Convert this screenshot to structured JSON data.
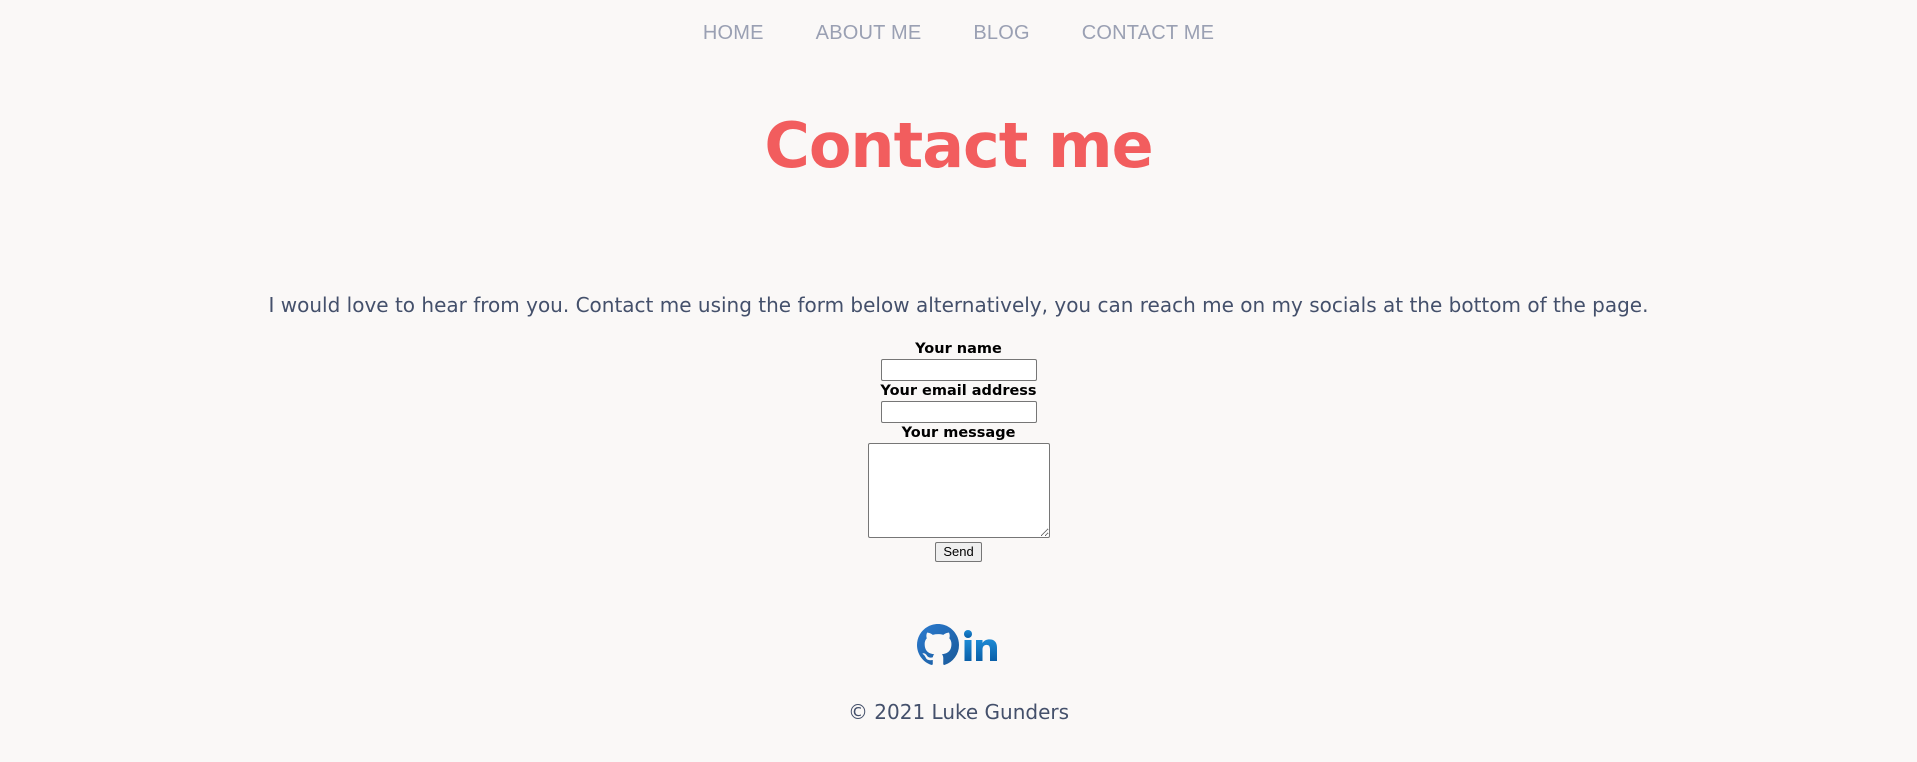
{
  "nav": {
    "items": [
      {
        "label": "HOME"
      },
      {
        "label": "ABOUT ME"
      },
      {
        "label": "BLOG"
      },
      {
        "label": "CONTACT ME"
      }
    ]
  },
  "page": {
    "title": "Contact me",
    "intro": "I would love to hear from you. Contact me using the form below alternatively, you can reach me on my socials at the bottom of the page."
  },
  "form": {
    "name_label": "Your name",
    "name_value": "",
    "email_label": "Your email address",
    "email_value": "",
    "message_label": "Your message",
    "message_value": "",
    "send_label": "Send"
  },
  "socials": {
    "icons": [
      "github-icon",
      "linkedin-icon"
    ]
  },
  "footer": {
    "copyright": "© 2021 Luke Gunders"
  },
  "colors": {
    "background": "#faf8f7",
    "title": "#f25d5e",
    "nav": "#9aa0b3",
    "body_text": "#44506b",
    "github": "#1f6cb3",
    "linkedin": "#0a66c2"
  }
}
